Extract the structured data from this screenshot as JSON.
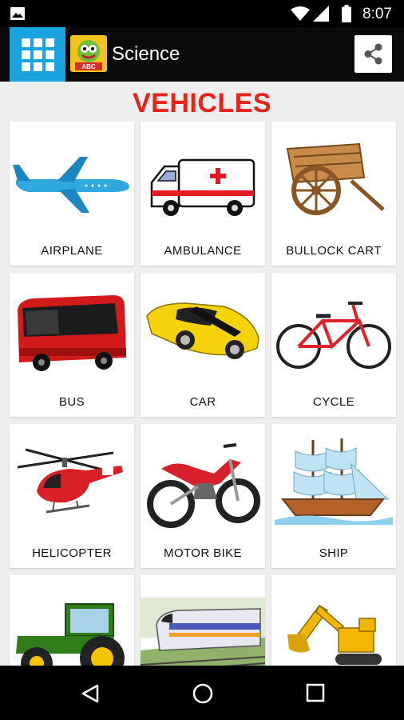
{
  "status_bar": {
    "time": "8:07"
  },
  "app_bar": {
    "title": "Science",
    "logo_text": "ABC"
  },
  "page": {
    "heading": "VEHICLES",
    "items": [
      {
        "label": "AIRPLANE"
      },
      {
        "label": "AMBULANCE"
      },
      {
        "label": "BULLOCK CART"
      },
      {
        "label": "BUS"
      },
      {
        "label": "CAR"
      },
      {
        "label": "CYCLE"
      },
      {
        "label": "HELICOPTER"
      },
      {
        "label": "MOTOR BIKE"
      },
      {
        "label": "SHIP"
      },
      {
        "label": ""
      },
      {
        "label": ""
      },
      {
        "label": ""
      }
    ]
  },
  "colors": {
    "accent": "#1aa3de",
    "heading": "#e8231a",
    "app_bar": "#0a0a0a"
  },
  "icons": [
    "image-icon",
    "wifi-icon",
    "signal-icon",
    "battery-icon",
    "grid-menu-icon",
    "share-icon",
    "back-icon",
    "home-icon",
    "recents-icon"
  ]
}
